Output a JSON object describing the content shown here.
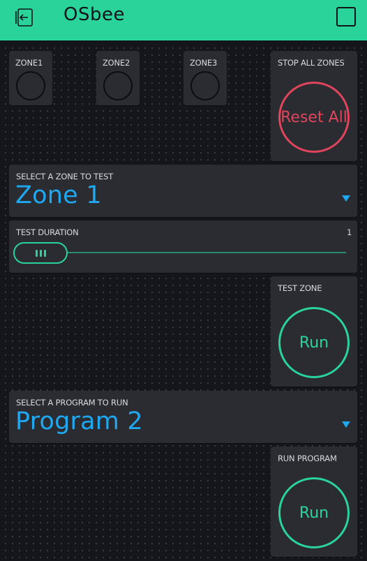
{
  "header": {
    "title": "OSbee",
    "back_icon": "exit-icon",
    "menu_icon": "square-icon",
    "bg_color": "#2ad39a"
  },
  "zones": [
    {
      "label": "ZONE1"
    },
    {
      "label": "ZONE2"
    },
    {
      "label": "ZONE3"
    }
  ],
  "stop_all": {
    "label": "STOP ALL ZONES",
    "button": "Reset All",
    "color": "#e0455c"
  },
  "zone_select": {
    "label": "SELECT A ZONE TO TEST",
    "value": "Zone 1"
  },
  "test_duration": {
    "label": "TEST DURATION",
    "value": "1",
    "fraction": 0.0
  },
  "test_zone": {
    "label": "TEST ZONE",
    "button": "Run"
  },
  "program_select": {
    "label": "SELECT A PROGRAM TO RUN",
    "value": "Program 2"
  },
  "run_program": {
    "label": "RUN PROGRAM",
    "button": "Run"
  },
  "colors": {
    "accent": "#2ad39a",
    "value_blue": "#1fa8f0",
    "danger": "#e0455c"
  }
}
